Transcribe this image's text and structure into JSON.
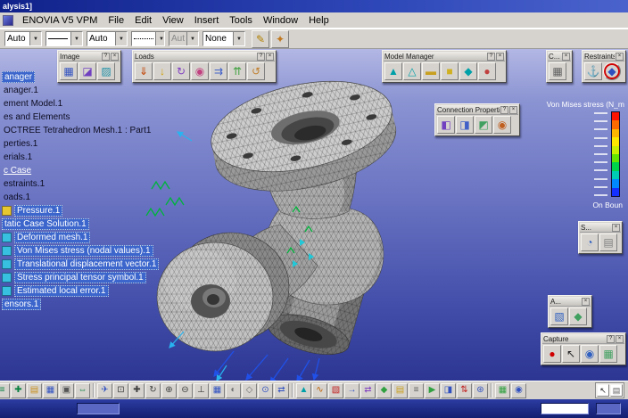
{
  "window": {
    "title": "alysis1]"
  },
  "chrome": {
    "dropdown_glyph": "▼"
  },
  "menu": {
    "items": [
      "ENOVIA V5 VPM",
      "File",
      "Edit",
      "View",
      "Insert",
      "Tools",
      "Window",
      "Help"
    ]
  },
  "combobar": {
    "combos": [
      {
        "name": "graphic-style-combo",
        "value": "Auto"
      },
      {
        "name": "line-type-combo",
        "value": "",
        "sample": "line"
      },
      {
        "name": "line-weight-combo",
        "value": "Auto"
      },
      {
        "name": "point-type-combo",
        "value": "",
        "sample": "dot"
      },
      {
        "name": "arrow-type-combo",
        "value": "Aut",
        "disabled": true
      },
      {
        "name": "render-mode-combo",
        "value": "None"
      }
    ],
    "tools": [
      {
        "name": "painter-icon",
        "glyph": "✎",
        "color": "#b08000"
      },
      {
        "name": "wizard-icon",
        "glyph": "✦",
        "color": "#c07820"
      }
    ]
  },
  "toolbars": {
    "chrome": {
      "help_glyph": "?",
      "close_glyph": "×"
    },
    "image": {
      "title": "Image",
      "icons": [
        {
          "name": "mesh-image-icon",
          "glyph": "▦",
          "color": "#3050c0"
        },
        {
          "name": "deformation-image-icon",
          "glyph": "◪",
          "color": "#7040c0"
        },
        {
          "name": "image-edition-icon",
          "glyph": "▨",
          "color": "#2090a8"
        }
      ]
    },
    "loads": {
      "title": "Loads",
      "icons": [
        {
          "name": "pressure-icon",
          "glyph": "⇓",
          "color": "#c04000"
        },
        {
          "name": "distributed-force-icon",
          "glyph": "↓",
          "color": "#d0a000"
        },
        {
          "name": "moment-icon",
          "glyph": "↻",
          "color": "#8040c0"
        },
        {
          "name": "bearing-load-icon",
          "glyph": "◉",
          "color": "#c04080"
        },
        {
          "name": "imported-force-icon",
          "glyph": "⇉",
          "color": "#4060c8"
        },
        {
          "name": "acceleration-icon",
          "glyph": "⇈",
          "color": "#40a040"
        },
        {
          "name": "rotation-force-icon",
          "glyph": "↺",
          "color": "#c08030"
        }
      ]
    },
    "model_manager": {
      "title": "Model Manager",
      "icons": [
        {
          "name": "tetrahedron-mesh-icon",
          "glyph": "▲",
          "color": "#00a0a8"
        },
        {
          "name": "surface-mesh-icon",
          "glyph": "△",
          "color": "#00a0a8"
        },
        {
          "name": "beam-mesh-icon",
          "glyph": "▬",
          "color": "#c8a020"
        },
        {
          "name": "solid-property-icon",
          "glyph": "■",
          "color": "#d0b020"
        },
        {
          "name": "shell-property-icon",
          "glyph": "◆",
          "color": "#00a0a8"
        },
        {
          "name": "material-icon",
          "glyph": "●",
          "color": "#c04040"
        }
      ]
    },
    "compute": {
      "title": "C...",
      "icons": [
        {
          "name": "compute-icon",
          "glyph": "▦",
          "color": "#606060"
        }
      ]
    },
    "restraints": {
      "title": "Restraints",
      "icons": [
        {
          "name": "clamp-icon",
          "glyph": "⚓",
          "color": "#3050c0"
        },
        {
          "name": "isostatic-restraint-icon",
          "glyph": "◆",
          "color": "#3050c0",
          "ring": true
        }
      ]
    },
    "connection_properties": {
      "title": "Connection Properties",
      "icons": [
        {
          "name": "slider-connection-icon",
          "glyph": "◧",
          "color": "#7040c0"
        },
        {
          "name": "contact-connection-icon",
          "glyph": "◨",
          "color": "#4060c8"
        },
        {
          "name": "fastened-connection-icon",
          "glyph": "◩",
          "color": "#40a060"
        },
        {
          "name": "bolt-tightening-icon",
          "glyph": "◉",
          "color": "#c06020"
        }
      ]
    },
    "sensors": {
      "title": "S...",
      "icons": [
        {
          "name": "sensor-icon",
          "glyph": "◔",
          "color": "#3060c0"
        },
        {
          "name": "storage-icon",
          "glyph": "▤",
          "color": "#808080"
        }
      ]
    },
    "adaptivity": {
      "title": "A...",
      "icons": [
        {
          "name": "adaptivity-box-icon",
          "glyph": "▧",
          "color": "#3060c0"
        },
        {
          "name": "convergence-icon",
          "glyph": "◆",
          "color": "#40a060"
        }
      ]
    },
    "capture": {
      "title": "Capture",
      "icons": [
        {
          "name": "record-icon",
          "glyph": "●",
          "color": "#d00000"
        },
        {
          "name": "capture-pointer-icon",
          "glyph": "↖",
          "color": "#202020"
        },
        {
          "name": "camera-icon",
          "glyph": "◉",
          "color": "#3060c0"
        },
        {
          "name": "album-icon",
          "glyph": "▦",
          "color": "#40a060"
        }
      ]
    }
  },
  "capture_controls": [
    {
      "name": "capture-select-icon",
      "glyph": "↖",
      "color": "#202020"
    },
    {
      "name": "capture-options-icon",
      "glyph": "▤",
      "color": "#606060"
    }
  ],
  "bottombar": {
    "standard": [
      {
        "name": "graph-tree-icon",
        "glyph": "≡",
        "color": "#0a8040"
      },
      {
        "name": "axis-icon",
        "glyph": "✚",
        "color": "#0a8040"
      },
      {
        "name": "open-icon",
        "glyph": "▤",
        "color": "#c89020"
      },
      {
        "name": "save-icon",
        "glyph": "▦",
        "color": "#3050c0"
      },
      {
        "name": "print-icon",
        "glyph": "▣",
        "color": "#555555"
      },
      {
        "name": "link-icon",
        "glyph": "⇔",
        "color": "#0a8040"
      }
    ],
    "view": [
      {
        "name": "fly-mode-icon",
        "glyph": "✈",
        "color": "#3050c0"
      },
      {
        "name": "fit-all-icon",
        "glyph": "⊡",
        "color": "#404040"
      },
      {
        "name": "pan-icon",
        "glyph": "✚",
        "color": "#404040"
      },
      {
        "name": "rotate-icon",
        "glyph": "↻",
        "color": "#404040"
      },
      {
        "name": "zoom-in-icon",
        "glyph": "⊕",
        "color": "#404040"
      },
      {
        "name": "zoom-out-icon",
        "glyph": "⊖",
        "color": "#404040"
      },
      {
        "name": "normal-view-icon",
        "glyph": "⊥",
        "color": "#404040"
      },
      {
        "name": "multi-view-icon",
        "glyph": "▦",
        "color": "#3050c0"
      },
      {
        "name": "shading-icon",
        "glyph": "◐",
        "color": "#707070"
      },
      {
        "name": "wireframe-icon",
        "glyph": "◇",
        "color": "#707070"
      },
      {
        "name": "hide-show-icon",
        "glyph": "⊙",
        "color": "#3050c0"
      },
      {
        "name": "swap-space-icon",
        "glyph": "⇄",
        "color": "#3050c0"
      }
    ],
    "analysis": [
      {
        "name": "mesh-visualization-icon",
        "glyph": "▲",
        "color": "#00a0a8"
      },
      {
        "name": "deformation-icon",
        "glyph": "∿",
        "color": "#c06000"
      },
      {
        "name": "von-mises-icon",
        "glyph": "▧",
        "color": "#c02020"
      },
      {
        "name": "displacement-icon",
        "glyph": "→",
        "color": "#3050c0"
      },
      {
        "name": "principal-stress-icon",
        "glyph": "⇄",
        "color": "#8040c0"
      },
      {
        "name": "precision-icon",
        "glyph": "◆",
        "color": "#30a040"
      },
      {
        "name": "report-icon",
        "glyph": "▤",
        "color": "#c8a020"
      },
      {
        "name": "historic-icon",
        "glyph": "≡",
        "color": "#606060"
      },
      {
        "name": "animate-icon",
        "glyph": "▶",
        "color": "#30a040"
      },
      {
        "name": "cut-plane-icon",
        "glyph": "◨",
        "color": "#3050c0"
      },
      {
        "name": "amplification-icon",
        "glyph": "⇅",
        "color": "#c02020"
      },
      {
        "name": "extrema-icon",
        "glyph": "⊛",
        "color": "#3050c0"
      }
    ],
    "right": [
      {
        "name": "image-layout-icon",
        "glyph": "▦",
        "color": "#30a040"
      },
      {
        "name": "simplified-rep-icon",
        "glyph": "◉",
        "color": "#3050c0"
      }
    ]
  },
  "tree": {
    "items": [
      {
        "label": "anager",
        "selected": true
      },
      {
        "label": "anager.1"
      },
      {
        "label": "ement Model.1"
      },
      {
        "label": "es and Elements"
      },
      {
        "label": "OCTREE Tetrahedron Mesh.1 : Part1"
      },
      {
        "label": "perties.1"
      },
      {
        "label": "erials.1"
      },
      {
        "label": "c Case",
        "link": true
      },
      {
        "label": "estraints.1"
      },
      {
        "label": "oads.1"
      },
      {
        "label": "Pressure.1",
        "selected": true,
        "icon_visible": true,
        "icon": "#e8c830",
        "icon_name": "pressure-node-icon"
      },
      {
        "label": "tatic Case Solution.1",
        "selected": true
      },
      {
        "label": "Deformed mesh.1",
        "selected": true,
        "icon_visible": true,
        "icon": "#38c0e0",
        "icon_name": "deformed-mesh-node-icon"
      },
      {
        "label": "Von Mises stress (nodal values).1",
        "selected": true,
        "icon_visible": true,
        "icon": "#38c0e0",
        "icon_name": "von-mises-node-icon"
      },
      {
        "label": "Translational displacement vector.1",
        "selected": true,
        "icon_visible": true,
        "icon": "#38c0e0",
        "icon_name": "displacement-node-icon"
      },
      {
        "label": "Stress principal tensor symbol.1",
        "selected": true,
        "icon_visible": true,
        "icon": "#38c0e0",
        "icon_name": "tensor-node-icon"
      },
      {
        "label": "Estimated local error.1",
        "selected": true,
        "icon_visible": true,
        "icon": "#38c0e0",
        "icon_name": "error-node-icon"
      },
      {
        "label": "ensors.1",
        "selected": true
      }
    ]
  },
  "legend": {
    "title": "Von Mises stress (N_m",
    "footer": "On Boun",
    "colors": [
      "#ff1400",
      "#ff6a00",
      "#ffb400",
      "#ffe800",
      "#c8f000",
      "#64e400",
      "#00d24c",
      "#00ccb4",
      "#0088ff",
      "#1430ff"
    ],
    "ticks": 11
  }
}
